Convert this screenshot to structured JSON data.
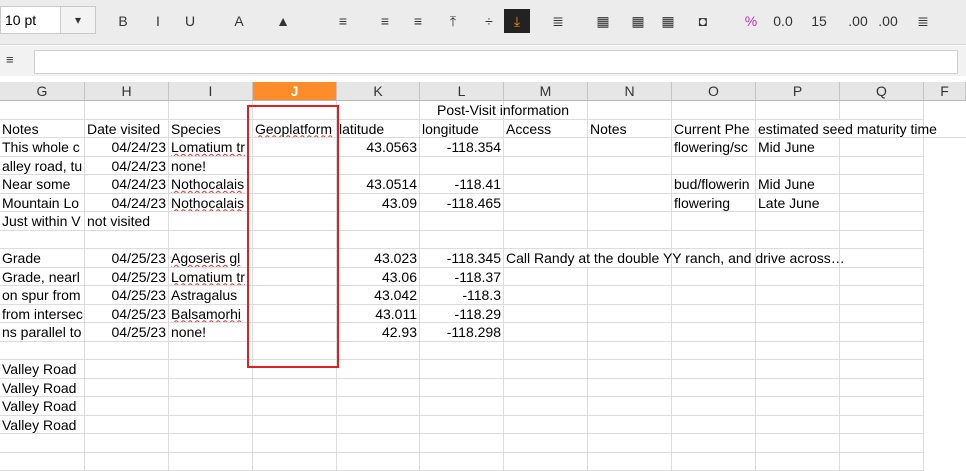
{
  "toolbar": {
    "font_size": "10 pt",
    "buttons": [
      {
        "name": "bold-button",
        "glyph": "B"
      },
      {
        "name": "italic-button",
        "glyph": "I"
      },
      {
        "name": "underline-button",
        "glyph": "U"
      },
      {
        "name": "font-color-button",
        "glyph": "A"
      },
      {
        "name": "highlight-button",
        "glyph": "▲"
      },
      {
        "name": "align-left-button",
        "glyph": "≡"
      },
      {
        "name": "align-center-button",
        "glyph": "≡"
      },
      {
        "name": "align-right-button",
        "glyph": "≡"
      },
      {
        "name": "align-top-button",
        "glyph": "⤒"
      },
      {
        "name": "align-middle-button",
        "glyph": "÷"
      },
      {
        "name": "align-bottom-button",
        "glyph": "⤓"
      },
      {
        "name": "wrap-button",
        "glyph": "≣"
      },
      {
        "name": "merge-button",
        "glyph": "▦"
      },
      {
        "name": "unmerge-button",
        "glyph": "▦"
      },
      {
        "name": "borders-button",
        "glyph": "▦"
      },
      {
        "name": "currency-button",
        "glyph": "◘"
      },
      {
        "name": "percent-button",
        "glyph": "%"
      },
      {
        "name": "number-button",
        "glyph": "0.0"
      },
      {
        "name": "date-button",
        "glyph": "15"
      },
      {
        "name": "add-decimal-button",
        "glyph": ".00"
      },
      {
        "name": "remove-decimal-button",
        "glyph": ".00"
      },
      {
        "name": "indent-button",
        "glyph": "≣"
      }
    ]
  },
  "columns": [
    "G",
    "H",
    "I",
    "J",
    "K",
    "L",
    "M",
    "N",
    "O",
    "P",
    "Q",
    "F"
  ],
  "selected_column": "J",
  "rows": [
    {
      "G": "",
      "H": "",
      "I": "",
      "J": "",
      "K": "",
      "L": "",
      "M": "",
      "N": "",
      "O": "",
      "P": "",
      "Q": ""
    },
    {
      "G": "Notes",
      "H": "Date visited",
      "I": "Species",
      "J": "Geoplatform",
      "K": "latitude",
      "L": "longitude",
      "M": "Access",
      "N": "Notes",
      "O": "Current Phe",
      "P": "estimated seed maturity time",
      "Q": ""
    },
    {
      "G": "This whole c",
      "H": "04/24/23",
      "I": "Lomatium tr",
      "J": "",
      "K": "43.0563",
      "L": "-118.354",
      "M": "",
      "N": "",
      "O": "flowering/sc",
      "P": "Mid June",
      "Q": ""
    },
    {
      "G": "alley road, tu",
      "H": "04/24/23",
      "I": "none!",
      "J": "",
      "K": "",
      "L": "",
      "M": "",
      "N": "",
      "O": "",
      "P": "",
      "Q": ""
    },
    {
      "G": "Near some",
      "H": "04/24/23",
      "I": "Nothocalais",
      "J": "",
      "K": "43.0514",
      "L": "-118.41",
      "M": "",
      "N": "",
      "O": "bud/flowerin",
      "P": "Mid June",
      "Q": ""
    },
    {
      "G": "Mountain Lo",
      "H": "04/24/23",
      "I": "Nothocalais",
      "J": "",
      "K": "43.09",
      "L": "-118.465",
      "M": "",
      "N": "",
      "O": "flowering",
      "P": "Late June",
      "Q": ""
    },
    {
      "G": "Just within V",
      "H": "not visited",
      "I": "",
      "J": "",
      "K": "",
      "L": "",
      "M": "",
      "N": "",
      "O": "",
      "P": "",
      "Q": ""
    },
    {
      "G": "",
      "H": "",
      "I": "",
      "J": "",
      "K": "",
      "L": "",
      "M": "",
      "N": "",
      "O": "",
      "P": "",
      "Q": ""
    },
    {
      "G": "Grade",
      "H": "04/25/23",
      "I": "Agoseris gl",
      "J": "",
      "K": "43.023",
      "L": "-118.345",
      "M": "Call Randy at the double YY ranch, and drive across…",
      "N": "",
      "O": "",
      "P": "",
      "Q": ""
    },
    {
      "G": "Grade, nearl",
      "H": "04/25/23",
      "I": "Lomatium tr",
      "J": "",
      "K": "43.06",
      "L": "-118.37",
      "M": "",
      "N": "",
      "O": "",
      "P": "",
      "Q": ""
    },
    {
      "G": "on spur from",
      "H": "04/25/23",
      "I": "Astragalus",
      "J": "",
      "K": "43.042",
      "L": "-118.3",
      "M": "",
      "N": "",
      "O": "",
      "P": "",
      "Q": ""
    },
    {
      "G": "from intersec",
      "H": "04/25/23",
      "I": "Balsamorhi",
      "J": "",
      "K": "43.011",
      "L": "-118.29",
      "M": "",
      "N": "",
      "O": "",
      "P": "",
      "Q": ""
    },
    {
      "G": "ns parallel to",
      "H": "04/25/23",
      "I": "none!",
      "J": "",
      "K": "42.93",
      "L": "-118.298",
      "M": "",
      "N": "",
      "O": "",
      "P": "",
      "Q": ""
    },
    {
      "G": "",
      "H": "",
      "I": "",
      "J": "",
      "K": "",
      "L": "",
      "M": "",
      "N": "",
      "O": "",
      "P": "",
      "Q": ""
    },
    {
      "G": "Valley Road",
      "H": "",
      "I": "",
      "J": "",
      "K": "",
      "L": "",
      "M": "",
      "N": "",
      "O": "",
      "P": "",
      "Q": ""
    },
    {
      "G": "Valley Road",
      "H": "",
      "I": "",
      "J": "",
      "K": "",
      "L": "",
      "M": "",
      "N": "",
      "O": "",
      "P": "",
      "Q": ""
    },
    {
      "G": "Valley Road",
      "H": "",
      "I": "",
      "J": "",
      "K": "",
      "L": "",
      "M": "",
      "N": "",
      "O": "",
      "P": "",
      "Q": ""
    },
    {
      "G": "Valley Road",
      "H": "",
      "I": "",
      "J": "",
      "K": "",
      "L": "",
      "M": "",
      "N": "",
      "O": "",
      "P": "",
      "Q": ""
    },
    {
      "G": "",
      "H": "",
      "I": "",
      "J": "",
      "K": "",
      "L": "",
      "M": "",
      "N": "",
      "O": "",
      "P": "",
      "Q": ""
    },
    {
      "G": "",
      "H": "",
      "I": "",
      "J": "",
      "K": "",
      "L": "",
      "M": "",
      "N": "",
      "O": "",
      "P": "",
      "Q": ""
    }
  ],
  "merged_header": "Post-Visit information"
}
